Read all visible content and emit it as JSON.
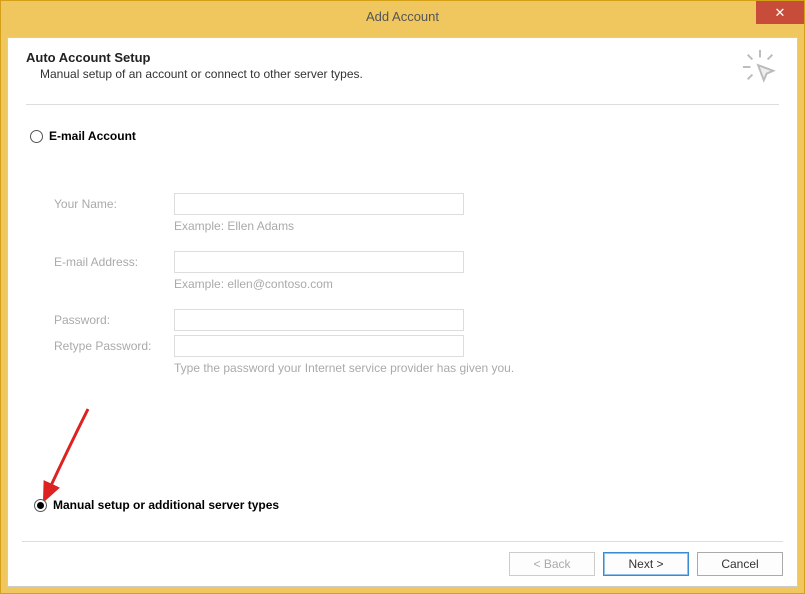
{
  "window": {
    "title": "Add Account",
    "close_symbol": "✕"
  },
  "header": {
    "title": "Auto Account Setup",
    "subtitle": "Manual setup of an account or connect to other server types."
  },
  "radios": {
    "email_account_label": "E-mail Account",
    "manual_setup_label": "Manual setup or additional server types"
  },
  "form": {
    "your_name_label": "Your Name:",
    "your_name_hint": "Example: Ellen Adams",
    "email_label": "E-mail Address:",
    "email_hint": "Example: ellen@contoso.com",
    "password_label": "Password:",
    "retype_password_label": "Retype Password:",
    "password_hint": "Type the password your Internet service provider has given you."
  },
  "buttons": {
    "back": "< Back",
    "next": "Next >",
    "cancel": "Cancel"
  }
}
